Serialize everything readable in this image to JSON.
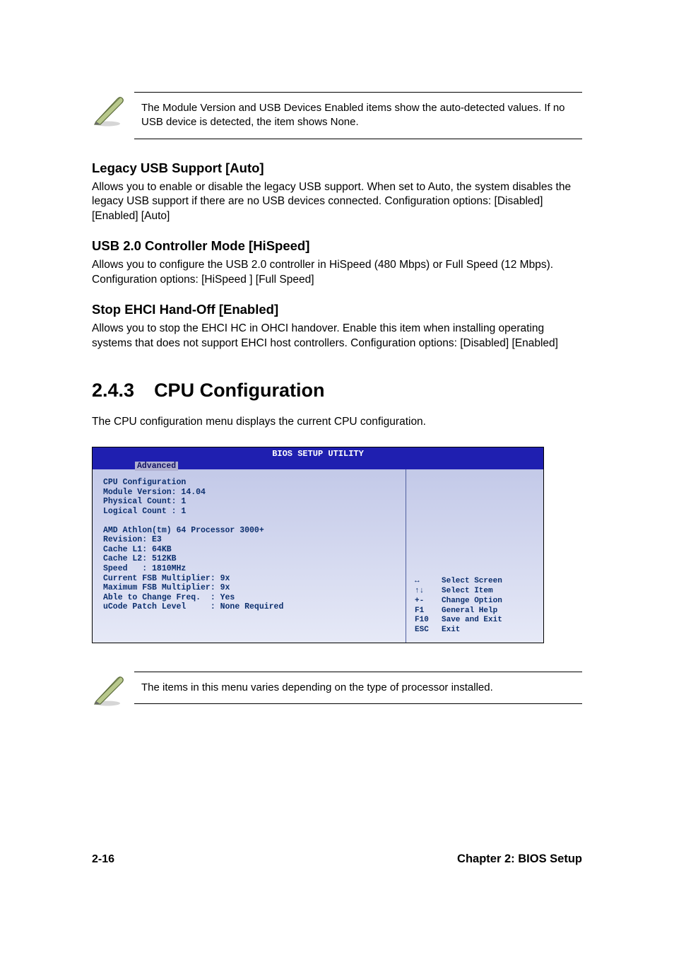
{
  "note1": "The Module Version and USB Devices Enabled items show the auto-detected values. If no USB device is detected, the item shows None.",
  "sections": {
    "legacy": {
      "heading": "Legacy USB Support [Auto]",
      "body": "Allows you to enable or disable the legacy USB support. When set to Auto, the system disables the legacy USB support if there are no USB devices connected. Configuration options: [Disabled] [Enabled] [Auto]"
    },
    "usb20": {
      "heading": "USB 2.0 Controller Mode [HiSpeed]",
      "body": "Allows you to configure the USB 2.0 controller in HiSpeed (480 Mbps) or Full Speed (12 Mbps). Configuration options: [HiSpeed ] [Full Speed]"
    },
    "ehci": {
      "heading": "Stop EHCI Hand-Off [Enabled]",
      "body": "Allows you to stop the EHCI HC in OHCI handover. Enable this item when installing operating systems that does not support EHCI host controllers. Configuration options: [Disabled] [Enabled]"
    }
  },
  "cpu_section": {
    "number": "2.4.3",
    "title": "CPU Configuration",
    "intro": "The CPU configuration menu displays the current CPU configuration."
  },
  "bios": {
    "title": "BIOS SETUP UTILITY",
    "tab": "Advanced",
    "left": "CPU Configuration\nModule Version: 14.04\nPhysical Count: 1\nLogical Count : 1\n\nAMD Athlon(tm) 64 Processor 3000+\nRevision: E3\nCache L1: 64KB\nCache L2: 512KB\nSpeed   : 1810MHz\nCurrent FSB Multiplier: 9x\nMaximum FSB Multiplier: 9x\nAble to Change Freq.  : Yes\nuCode Patch Level     : None Required",
    "help": [
      {
        "key": "↔",
        "label": "Select Screen"
      },
      {
        "key": "↑↓",
        "label": "Select Item"
      },
      {
        "key": "+-",
        "label": "Change Option"
      },
      {
        "key": "F1",
        "label": "General Help"
      },
      {
        "key": "F10",
        "label": "Save and Exit"
      },
      {
        "key": "ESC",
        "label": "Exit"
      }
    ]
  },
  "note2": "The items in this menu varies depending on the type of processor installed.",
  "footer": {
    "page": "2-16",
    "chapter": "Chapter 2: BIOS Setup"
  }
}
